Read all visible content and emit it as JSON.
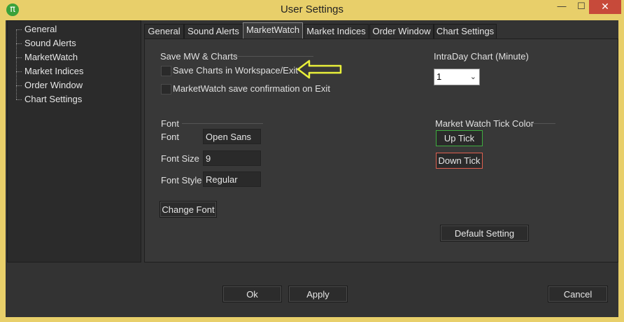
{
  "window": {
    "title": "User Settings",
    "app_icon": "π",
    "minimize": "—",
    "maximize": "☐",
    "close": "✕"
  },
  "sidebar": {
    "items": [
      "General",
      "Sound Alerts",
      "MarketWatch",
      "Market Indices",
      "Order Window",
      "Chart Settings"
    ]
  },
  "tabs": [
    {
      "label": "General"
    },
    {
      "label": "Sound Alerts"
    },
    {
      "label": "MarketWatch",
      "active": true
    },
    {
      "label": "Market Indices"
    },
    {
      "label": "Order Window"
    },
    {
      "label": "Chart Settings"
    }
  ],
  "save_group": {
    "title": "Save MW & Charts",
    "save_charts_label": "Save Charts in Workspace/Exit",
    "save_charts_checked": false,
    "confirm_label": "MarketWatch save confirmation on Exit",
    "confirm_checked": false
  },
  "intraday": {
    "label": "IntraDay Chart (Minute)",
    "value": "1"
  },
  "font_group": {
    "title": "Font",
    "font_label": "Font",
    "font_value": "Open Sans",
    "size_label": "Font Size",
    "size_value": "9",
    "style_label": "Font Style",
    "style_value": "Regular",
    "change_button": "Change Font"
  },
  "tick_color": {
    "label": "Market Watch Tick Color",
    "up": "Up Tick",
    "down": "Down Tick",
    "up_color": "#3fae3f",
    "down_color": "#e06050"
  },
  "default_button": "Default Setting",
  "footer": {
    "ok": "Ok",
    "apply": "Apply",
    "cancel": "Cancel"
  },
  "annotation": {
    "arrow_color": "#e9f03a"
  }
}
